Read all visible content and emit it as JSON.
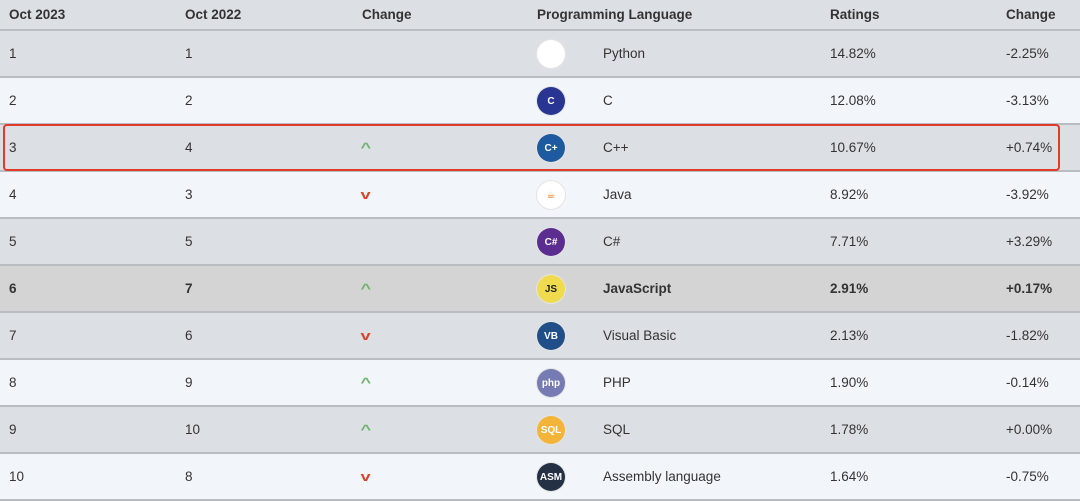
{
  "header": {
    "col_oct2023": "Oct 2023",
    "col_oct2022": "Oct 2022",
    "col_change": "Change",
    "col_language": "Programming Language",
    "col_ratings": "Ratings",
    "col_change_pct": "Change"
  },
  "colors": {
    "highlight_box": "#e03a2a",
    "up": "#6cb36c",
    "down": "#d9462b"
  },
  "rows": [
    {
      "rank2023": "1",
      "rank2022": "1",
      "trend": "",
      "language": "Python",
      "icon": "python-icon",
      "icon_text": "",
      "icon_bg": "#ffffff",
      "ratings": "14.82%",
      "change": "-2.25%"
    },
    {
      "rank2023": "2",
      "rank2022": "2",
      "trend": "",
      "language": "C",
      "icon": "c-icon",
      "icon_text": "C",
      "icon_bg": "#283593",
      "ratings": "12.08%",
      "change": "-3.13%"
    },
    {
      "rank2023": "3",
      "rank2022": "4",
      "trend": "up",
      "language": "C++",
      "icon": "cpp-icon",
      "icon_text": "C+",
      "icon_bg": "#1e5aa0",
      "ratings": "10.67%",
      "change": "+0.74%",
      "boxed": true
    },
    {
      "rank2023": "4",
      "rank2022": "3",
      "trend": "down",
      "language": "Java",
      "icon": "java-icon",
      "icon_text": "☕",
      "icon_bg": "#ffffff",
      "ratings": "8.92%",
      "change": "-3.92%"
    },
    {
      "rank2023": "5",
      "rank2022": "5",
      "trend": "",
      "language": "C#",
      "icon": "csharp-icon",
      "icon_text": "C#",
      "icon_bg": "#5c2d91",
      "ratings": "7.71%",
      "change": "+3.29%"
    },
    {
      "rank2023": "6",
      "rank2022": "7",
      "trend": "up",
      "language": "JavaScript",
      "icon": "javascript-icon",
      "icon_text": "JS",
      "icon_bg": "#f0db4f",
      "ratings": "2.91%",
      "change": "+0.17%",
      "highlight": true
    },
    {
      "rank2023": "7",
      "rank2022": "6",
      "trend": "down",
      "language": "Visual Basic",
      "icon": "visual-basic-icon",
      "icon_text": "VB",
      "icon_bg": "#1f4e88",
      "ratings": "2.13%",
      "change": "-1.82%"
    },
    {
      "rank2023": "8",
      "rank2022": "9",
      "trend": "up",
      "language": "PHP",
      "icon": "php-icon",
      "icon_text": "php",
      "icon_bg": "#777bb3",
      "ratings": "1.90%",
      "change": "-0.14%"
    },
    {
      "rank2023": "9",
      "rank2022": "10",
      "trend": "up",
      "language": "SQL",
      "icon": "sql-icon",
      "icon_text": "SQL",
      "icon_bg": "#f4b43a",
      "ratings": "1.78%",
      "change": "+0.00%"
    },
    {
      "rank2023": "10",
      "rank2022": "8",
      "trend": "down",
      "language": "Assembly language",
      "icon": "assembly-icon",
      "icon_text": "ASM",
      "icon_bg": "#243044",
      "ratings": "1.64%",
      "change": "-0.75%"
    }
  ]
}
